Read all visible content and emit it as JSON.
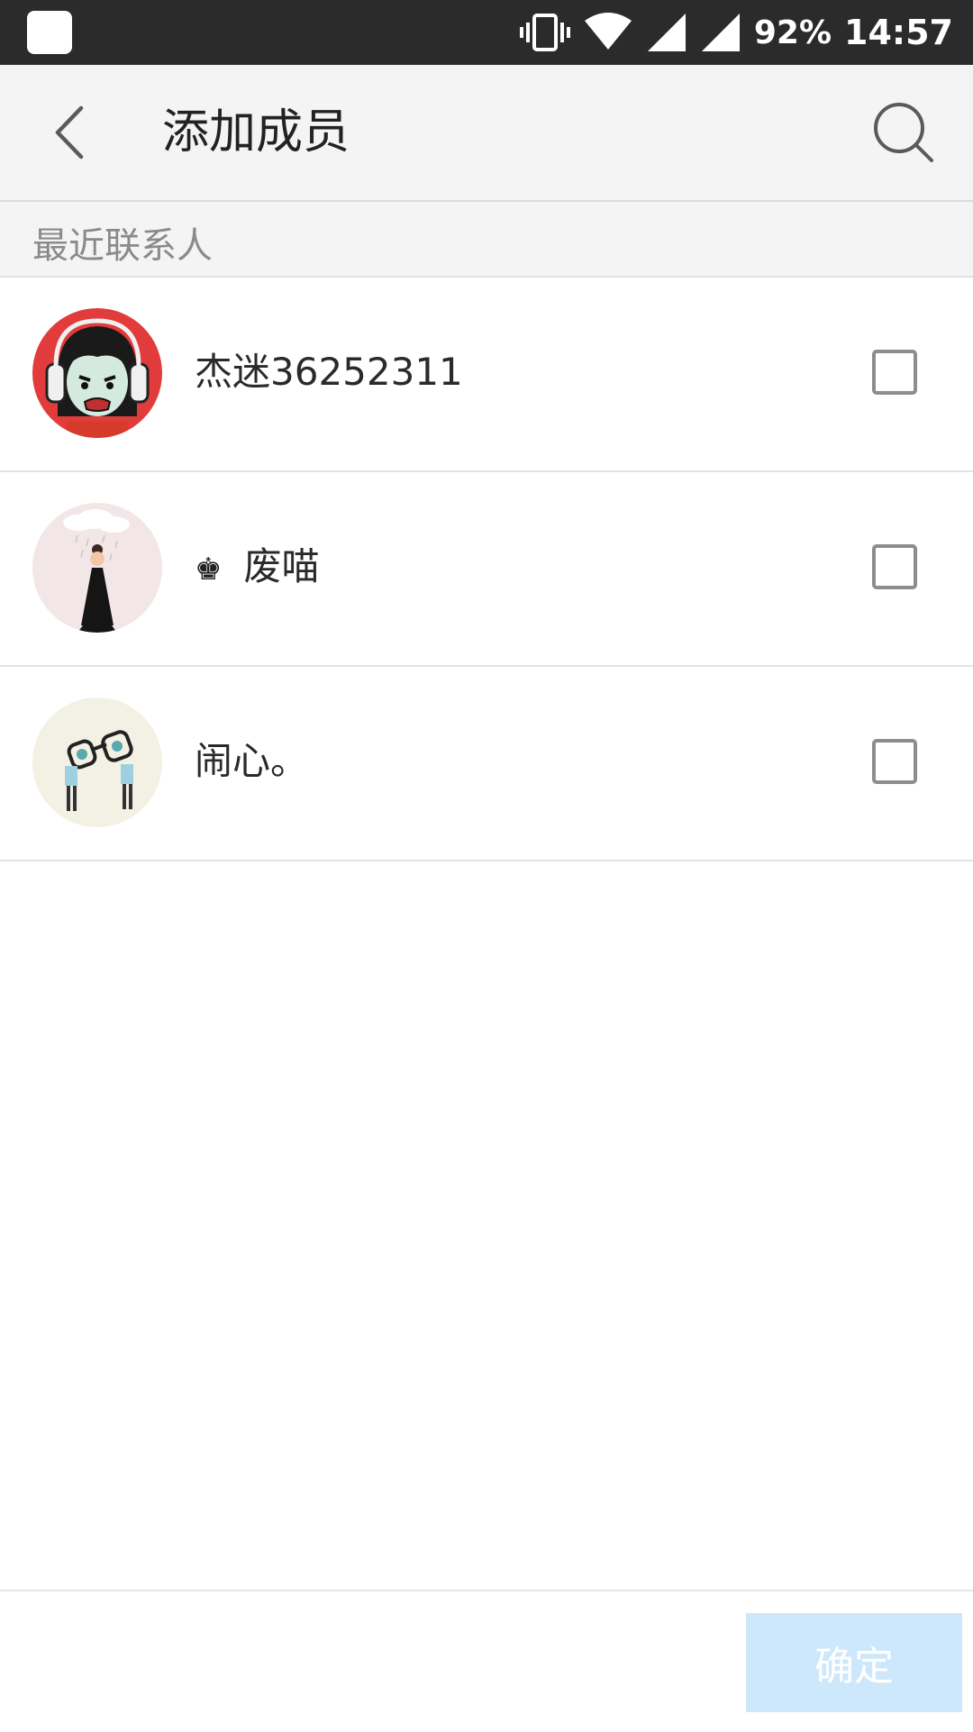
{
  "status_bar": {
    "battery_percent": "92%",
    "time": "14:57",
    "icons": [
      "vibrate-icon",
      "wifi-icon",
      "signal-icon",
      "signal-icon"
    ]
  },
  "header": {
    "title": "添加成员",
    "back_icon": "chevron-left-icon",
    "search_icon": "search-icon"
  },
  "section": {
    "label": "最近联系人"
  },
  "contacts": [
    {
      "name": "杰迷36252311",
      "checked": false,
      "avatar_icon": "avatar-headphones"
    },
    {
      "prefix_icon": "♚",
      "name": "废喵",
      "checked": false,
      "avatar_icon": "avatar-girl-rain"
    },
    {
      "name": "闹心。",
      "checked": false,
      "avatar_icon": "avatar-glasses"
    }
  ],
  "footer": {
    "confirm_label": "确定"
  },
  "colors": {
    "status_bar_bg": "#2b2b2b",
    "header_bg": "#f4f4f4",
    "confirm_disabled_bg": "#cde8fb"
  }
}
